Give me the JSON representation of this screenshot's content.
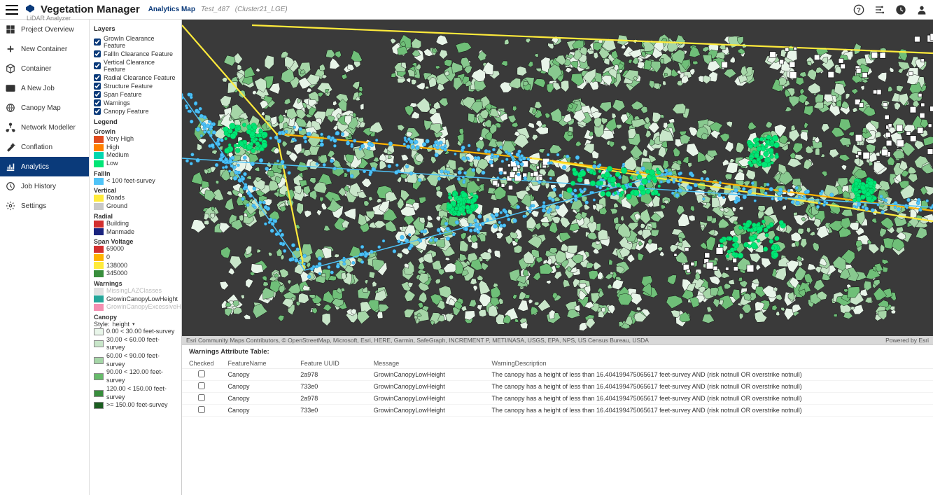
{
  "header": {
    "app_title": "Vegetation Manager",
    "subtitle": "LiDAR Analyzer",
    "breadcrumb": {
      "page": "Analytics Map",
      "test": "Test_487",
      "cluster": "(Cluster21_LGE)"
    }
  },
  "nav": [
    {
      "label": "Project Overview",
      "icon": "grid"
    },
    {
      "label": "New Container",
      "icon": "plus"
    },
    {
      "label": "Container",
      "icon": "cube"
    },
    {
      "label": "A New Job",
      "icon": "new"
    },
    {
      "label": "Canopy Map",
      "icon": "globe"
    },
    {
      "label": "Network Modeller",
      "icon": "network"
    },
    {
      "label": "Conflation",
      "icon": "wand"
    },
    {
      "label": "Analytics",
      "icon": "chart",
      "active": true
    },
    {
      "label": "Job History",
      "icon": "history"
    },
    {
      "label": "Settings",
      "icon": "gear"
    }
  ],
  "layers": {
    "heading": "Layers",
    "items": [
      "GrowIn Clearance Feature",
      "FallIn Clearance Feature",
      "Vertical Clearance Feature",
      "Radial Clearance Feature",
      "Structure Feature",
      "Span Feature",
      "Warnings",
      "Canopy Feature"
    ]
  },
  "legend": {
    "heading": "Legend",
    "groups": [
      {
        "title": "GrowIn",
        "rows": [
          {
            "c": "#e04b1f",
            "l": "Very High"
          },
          {
            "c": "#ff7f00",
            "l": "High"
          },
          {
            "c": "#00d7b0",
            "l": "Medium"
          },
          {
            "c": "#00e676",
            "l": "Low"
          }
        ]
      },
      {
        "title": "FallIn",
        "rows": [
          {
            "c": "#4fc3f7",
            "l": "< 100 feet-survey"
          }
        ]
      },
      {
        "title": "Vertical",
        "rows": [
          {
            "c": "#ffeb3b",
            "l": "Roads"
          },
          {
            "c": "#c8c8c8",
            "l": "Ground"
          }
        ]
      },
      {
        "title": "Radial",
        "rows": [
          {
            "c": "#d32f2f",
            "l": "Building"
          },
          {
            "c": "#1a237e",
            "l": "Manmade"
          }
        ]
      },
      {
        "title": "Span Voltage",
        "rows": [
          {
            "c": "#d32f2f",
            "l": "69000"
          },
          {
            "c": "#ffb300",
            "l": "0"
          },
          {
            "c": "#ffeb3b",
            "l": "138000"
          },
          {
            "c": "#388e3c",
            "l": "345000"
          }
        ]
      },
      {
        "title": "Warnings",
        "rows": [
          {
            "c": "#e0e0e0",
            "l": "MissingLAZClasses",
            "dim": true
          },
          {
            "c": "#26a69a",
            "l": "GrowinCanopyLowHeight"
          },
          {
            "c": "#f48fb1",
            "l": "GrowinCanopyExcessiveHeight",
            "dim": true
          }
        ]
      },
      {
        "title": "Canopy",
        "style_label": "Style:",
        "style_value": "height",
        "rows": [
          {
            "c": "#e8f5e9",
            "l": "0.00 < 30.00 feet-survey"
          },
          {
            "c": "#c8e6c9",
            "l": "30.00 < 60.00 feet-survey"
          },
          {
            "c": "#a5d6a7",
            "l": "60.00 < 90.00 feet-survey"
          },
          {
            "c": "#66bb6a",
            "l": "90.00 < 120.00 feet-survey"
          },
          {
            "c": "#388e3c",
            "l": "120.00 < 150.00 feet-survey"
          },
          {
            "c": "#1b5e20",
            "l": ">= 150.00 feet-survey"
          }
        ]
      }
    ]
  },
  "attribution": {
    "left": "Esri Community Maps Contributors, © OpenStreetMap, Microsoft, Esri, HERE, Garmin, SafeGraph, INCREMENT P, METI/NASA, USGS, EPA, NPS, US Census Bureau, USDA",
    "right": "Powered by Esri"
  },
  "table": {
    "title": "Warnings Attribute Table:",
    "headers": [
      "Checked",
      "FeatureName",
      "Feature UUID",
      "Message",
      "WarningDescription"
    ],
    "rows": [
      {
        "fn": "Canopy",
        "uuid": "2a978",
        "msg": "GrowinCanopyLowHeight",
        "desc": "The canopy has a height of less than 16.404199475065617 feet-survey AND (risk notnull OR overstrike notnull)"
      },
      {
        "fn": "Canopy",
        "uuid": "733e0",
        "msg": "GrowinCanopyLowHeight",
        "desc": "The canopy has a height of less than 16.404199475065617 feet-survey AND (risk notnull OR overstrike notnull)"
      },
      {
        "fn": "Canopy",
        "uuid": "2a978",
        "msg": "GrowinCanopyLowHeight",
        "desc": "The canopy has a height of less than 16.404199475065617 feet-survey AND (risk notnull OR overstrike notnull)"
      },
      {
        "fn": "Canopy",
        "uuid": "733e0",
        "msg": "GrowinCanopyLowHeight",
        "desc": "The canopy has a height of less than 16.404199475065617 feet-survey AND (risk notnull OR overstrike notnull)"
      }
    ]
  }
}
